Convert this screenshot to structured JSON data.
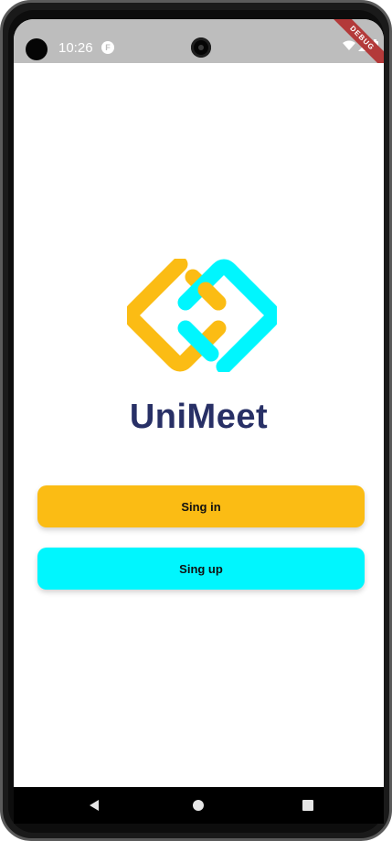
{
  "status_bar": {
    "time": "10:26",
    "app_icon": "F",
    "debug_banner": "DEBUG"
  },
  "app": {
    "title": "UniMeet",
    "logo_icon": "chain-link-logo",
    "colors": {
      "yellow": "#fbbc14",
      "cyan": "#00f6fe",
      "title": "#283066"
    }
  },
  "buttons": {
    "sign_in_label": "Sing in",
    "sign_up_label": "Sing up"
  },
  "nav_bar": {
    "icons": [
      "back-icon",
      "home-icon",
      "recents-icon"
    ]
  }
}
